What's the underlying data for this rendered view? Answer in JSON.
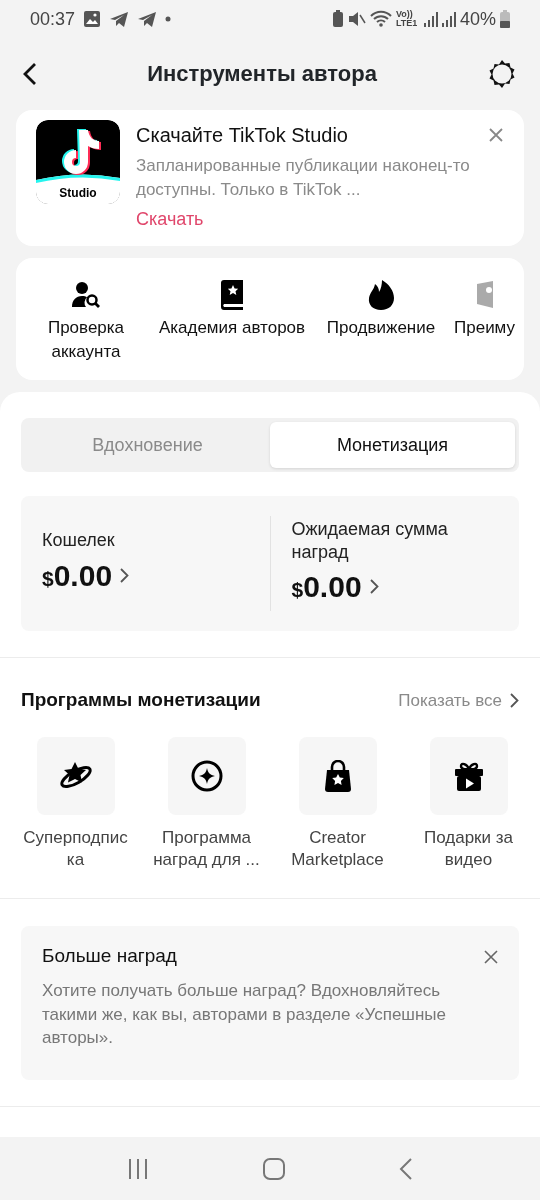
{
  "status_bar": {
    "time": "00:37",
    "network": "Vo)) LTE1",
    "battery": "40%"
  },
  "header": {
    "title": "Инструменты автора"
  },
  "promo": {
    "title": "Скачайте TikTok Studio",
    "text": "Запланированные публикации наконец-то доступны. Только в TikTok ...",
    "link": "Скачать",
    "logo_label": "Studio"
  },
  "tools": [
    {
      "label": "Проверка аккаунта",
      "kind": "user-search"
    },
    {
      "label": "Академия авторов",
      "kind": "book"
    },
    {
      "label": "Продвижение",
      "kind": "flame"
    },
    {
      "label": "Преиму",
      "kind": "shield"
    }
  ],
  "tabs": [
    {
      "label": "Вдохновение",
      "selected": false
    },
    {
      "label": "Монетизация",
      "selected": true
    }
  ],
  "balances": [
    {
      "label": "Кошелек",
      "currency": "$",
      "amount": "0.00"
    },
    {
      "label": "Ожидаемая сумма наград",
      "currency": "$",
      "amount": "0.00"
    }
  ],
  "programs": {
    "title": "Программы монетизации",
    "show_all": "Показать все",
    "items": [
      {
        "label": "Суперподпис ка",
        "kind": "planet"
      },
      {
        "label": "Программа наград для ...",
        "kind": "sparkle"
      },
      {
        "label": "Creator Marketplace",
        "kind": "bag"
      },
      {
        "label": "Подарки за видео",
        "kind": "gift"
      }
    ]
  },
  "rewards_card": {
    "title": "Больше наград",
    "text": "Хотите получать больше наград? Вдохновляйтесь такими же, как вы, авторами в разделе «Успешные авторы»."
  }
}
